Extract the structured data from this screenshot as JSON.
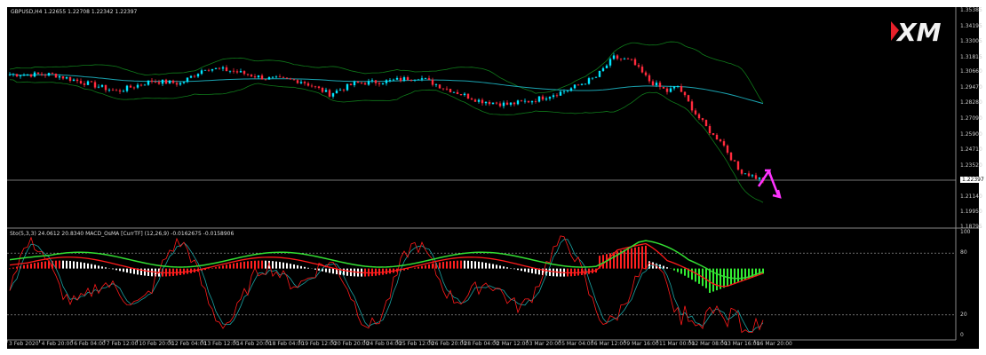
{
  "header": {
    "symbol": "GBPUSD,H4",
    "ohlc": "1.22655 1.22708 1.22342 1.22397"
  },
  "indicator_header": "Sto(5,3,3) 24.0612 20.8340  MACD_OsMA [CurrTF] (12,26,9) -0.0162675 -0.0158906",
  "logo": "XM",
  "colors": {
    "up": "#00e5ff",
    "down": "#ff2a3c",
    "bands": "#0f7a1a",
    "ma": "#1aa3b0",
    "arrow": "#ff33ff",
    "stoch_main": "#ff1a1a",
    "stoch_signal": "#1aa3a3",
    "osma_up": "#ffffff",
    "osma_down": "#ff2020",
    "osma_green": "#33ee33",
    "signal_green": "#33dd33"
  },
  "chart_data": {
    "type": "candlestick",
    "price_axis": [
      "1.35385",
      "1.34195",
      "1.33005",
      "1.31815",
      "1.30660",
      "1.29470",
      "1.28280",
      "1.27090",
      "1.25900",
      "1.24710",
      "1.23520",
      "1.22397",
      "1.21140",
      "1.19950",
      "1.18795"
    ],
    "current_price": "1.22397",
    "price_range": [
      1.18795,
      1.35385
    ],
    "close_keypoints": [
      [
        0,
        1.305
      ],
      [
        12,
        1.305
      ],
      [
        22,
        1.298
      ],
      [
        30,
        1.292
      ],
      [
        40,
        1.3
      ],
      [
        48,
        1.298
      ],
      [
        55,
        1.31
      ],
      [
        62,
        1.308
      ],
      [
        72,
        1.302
      ],
      [
        82,
        1.3
      ],
      [
        90,
        1.29
      ],
      [
        97,
        1.298
      ],
      [
        107,
        1.3
      ],
      [
        115,
        1.303
      ],
      [
        122,
        1.295
      ],
      [
        132,
        1.285
      ],
      [
        140,
        1.282
      ],
      [
        147,
        1.285
      ],
      [
        157,
        1.293
      ],
      [
        165,
        1.303
      ],
      [
        170,
        1.318
      ],
      [
        175,
        1.315
      ],
      [
        180,
        1.3
      ],
      [
        185,
        1.292
      ],
      [
        188,
        1.296
      ],
      [
        193,
        1.275
      ],
      [
        198,
        1.258
      ],
      [
        200,
        1.255
      ],
      [
        205,
        1.232
      ],
      [
        210,
        1.226
      ],
      [
        212,
        1.224
      ]
    ],
    "stoch_axis": [
      "100",
      "80",
      "20",
      "0"
    ],
    "stoch_levels": [
      80,
      20
    ],
    "time_axis": [
      "3 Feb 2020",
      "4 Feb 20:00",
      "6 Feb 04:00",
      "7 Feb 12:00",
      "10 Feb 20:00",
      "12 Feb 04:00",
      "13 Feb 12:00",
      "14 Feb 20:00",
      "18 Feb 04:00",
      "19 Feb 12:00",
      "20 Feb 20:00",
      "24 Feb 04:00",
      "25 Feb 12:00",
      "26 Feb 20:00",
      "28 Feb 04:00",
      "2 Mar 12:00",
      "3 Mar 20:00",
      "5 Mar 04:00",
      "6 Mar 12:00",
      "9 Mar 16:00",
      "11 Mar 00:00",
      "12 Mar 08:00",
      "13 Mar 16:00",
      "16 Mar 20:00"
    ]
  }
}
